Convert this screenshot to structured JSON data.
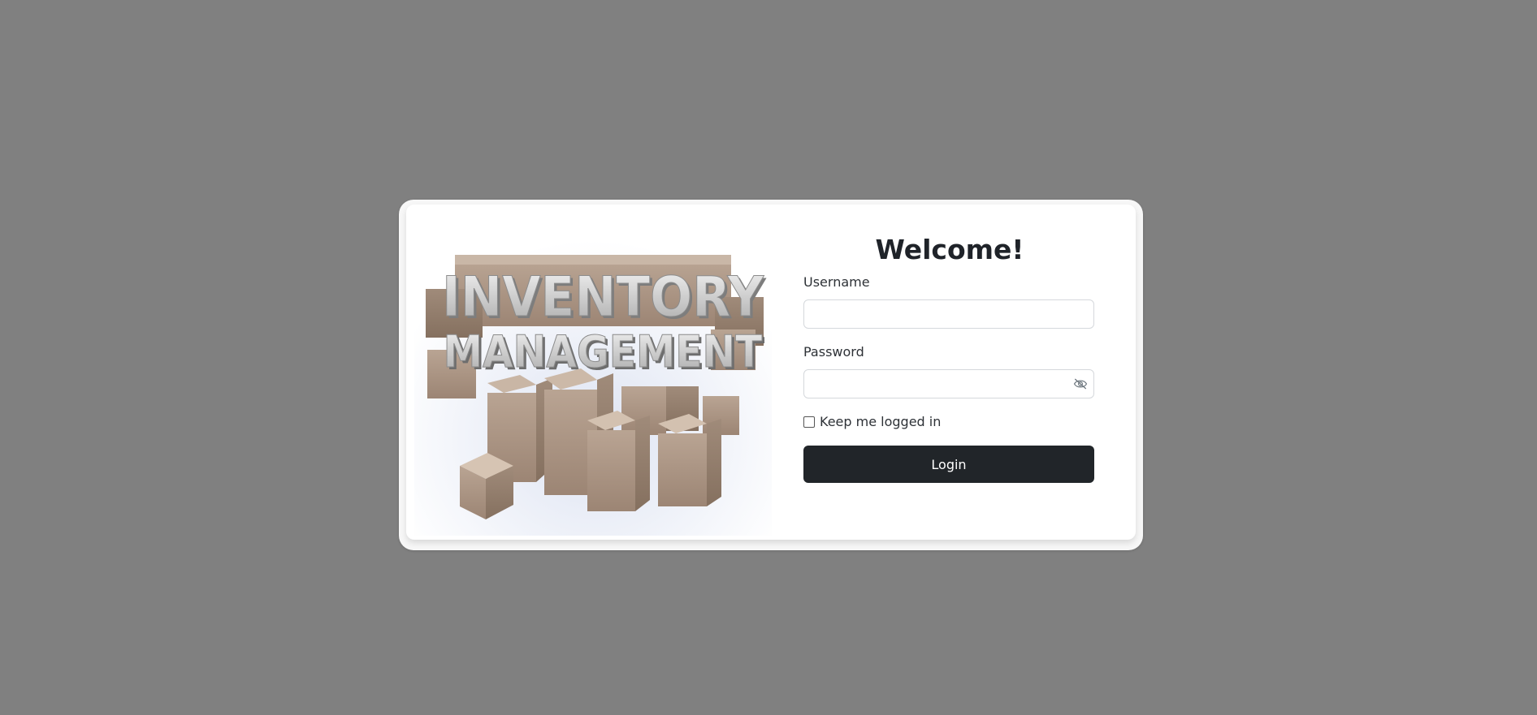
{
  "login": {
    "title": "Welcome!",
    "username_label": "Username",
    "username_value": "",
    "password_label": "Password",
    "password_value": "",
    "keep_logged_in_label": "Keep me logged in",
    "keep_logged_in_checked": false,
    "login_button_label": "Login"
  },
  "hero": {
    "line1": "INVENTORY",
    "line2": "MANAGEMENT"
  },
  "icons": {
    "password_toggle": "eye-slash-icon"
  },
  "colors": {
    "background": "#808080",
    "button": "#212529",
    "button_text": "#ffffff",
    "title": "#1f2329"
  }
}
